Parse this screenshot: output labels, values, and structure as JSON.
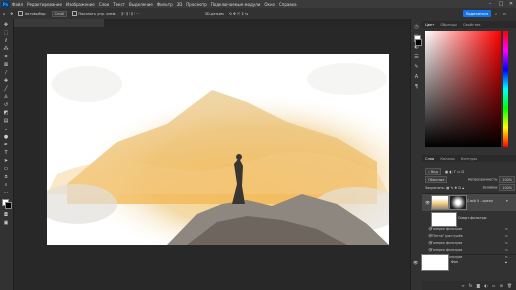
{
  "app": {
    "logo": "Ps",
    "menu": [
      "Файл",
      "Редактирование",
      "Изображение",
      "Слои",
      "Текст",
      "Выделение",
      "Фильтр",
      "3D",
      "Просмотр",
      "Подключаемые модули",
      "Окно",
      "Справка"
    ],
    "window_controls": [
      "–",
      "□",
      "✕"
    ]
  },
  "options": {
    "auto_select": "Автовыбор:",
    "auto_select_target": "Слой",
    "show_transform": "Показать упр. элем.",
    "mode_3d": "3D-режим",
    "share_label": "Поделиться"
  },
  "document": {
    "tab_title": ""
  },
  "panels": {
    "color_tabs": [
      "Цвет",
      "Образцы",
      "Свойства"
    ],
    "layers_tabs": [
      "Слои",
      "Каналы",
      "Контуры"
    ],
    "kind_label": "Вид",
    "blend_mode": "Обычные",
    "opacity_label": "Непрозрачность:",
    "opacity_value": "100%",
    "lock_label": "Закрепить:",
    "fill_label": "Заливка:",
    "fill_value": "100%"
  },
  "layers": {
    "smart_layer": {
      "name": "Слой 0 - ореол"
    },
    "smart_filters": {
      "name": "Смарт-фильтры"
    },
    "filters": [
      "Галерея фильтров",
      "\"Пятна\" (растушёв",
      "Галерея фильтров",
      "Галерея фильтров",
      "Галерея фильтров"
    ],
    "background": {
      "name": "Фон"
    }
  },
  "colors": {
    "accent": "#1473e6",
    "panel": "#323232",
    "canvas_bg": "#282828"
  },
  "icons": {
    "tools": [
      "move-icon",
      "marquee-icon",
      "lasso-icon",
      "magic-wand-icon",
      "crop-icon",
      "frame-icon",
      "eyedropper-icon",
      "healing-icon",
      "brush-icon",
      "stamp-icon",
      "history-brush-icon",
      "eraser-icon",
      "gradient-icon",
      "blur-icon",
      "dodge-icon",
      "pen-icon",
      "type-icon",
      "path-select-icon",
      "shape-icon",
      "hand-icon",
      "zoom-icon",
      "more-icon"
    ]
  }
}
